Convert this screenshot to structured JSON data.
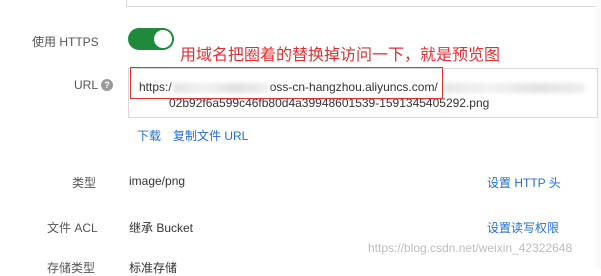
{
  "https": {
    "label": "使用 HTTPS",
    "enabled": true
  },
  "annotation": "用域名把圈着的替换掉访问一下，就是预览图",
  "url": {
    "label": "URL",
    "help_icon": "question-circle-icon",
    "line1_start": "https:/",
    "line1_mid": "oss-cn-hangzhou.aliyuncs.com/",
    "line2": "02b92f6a599c46fb80d4a39948601539-1591345405292.png",
    "download_label": "下载",
    "copy_label": "复制文件 URL"
  },
  "type": {
    "label": "类型",
    "value": "image/png",
    "action": "设置 HTTP 头"
  },
  "acl": {
    "label": "文件 ACL",
    "value": "继承 Bucket",
    "action": "设置读写权限"
  },
  "storage": {
    "label": "存储类型",
    "value": "标准存储"
  },
  "watermark": "https://blog.csdn.net/weixin_42322648",
  "colors": {
    "toggle_on": "#1e8a3a",
    "link": "#1f6fd1",
    "annotation": "#e03030"
  }
}
